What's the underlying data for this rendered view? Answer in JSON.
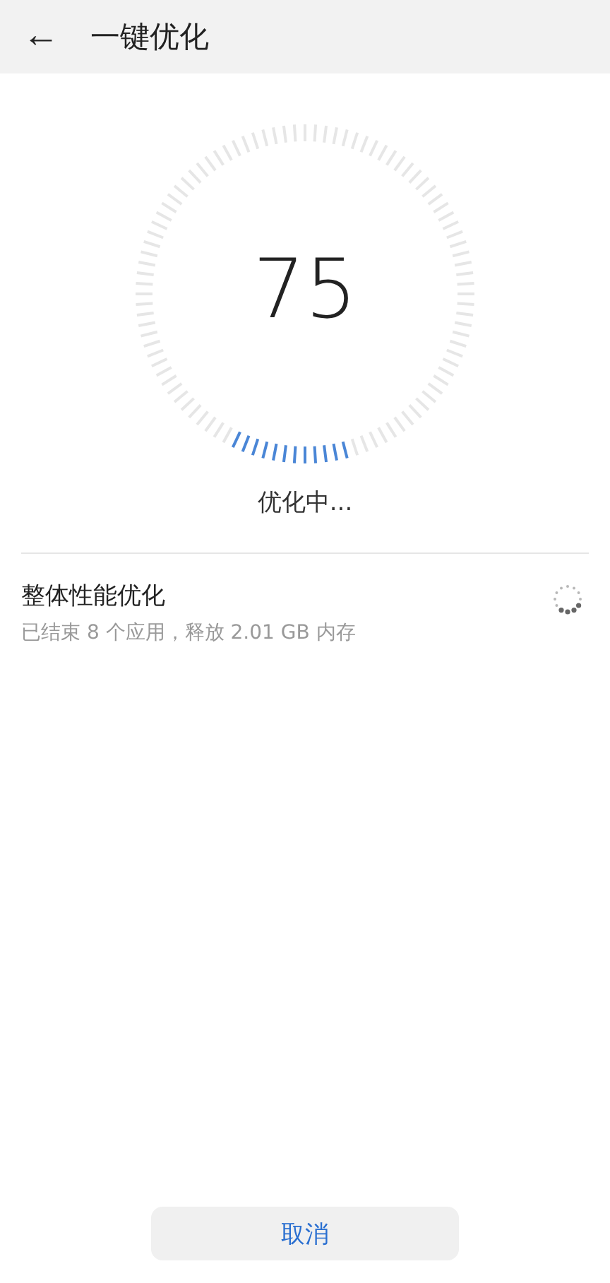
{
  "header": {
    "back": "←",
    "title": "一键优化"
  },
  "dial": {
    "score": "75",
    "status": "优化中..."
  },
  "tasks": [
    {
      "title": "整体性能优化",
      "detail": "已结束 8 个应用，释放 2.01 GB 内存",
      "running": true
    }
  ],
  "buttons": [
    {
      "label": "取消"
    }
  ]
}
